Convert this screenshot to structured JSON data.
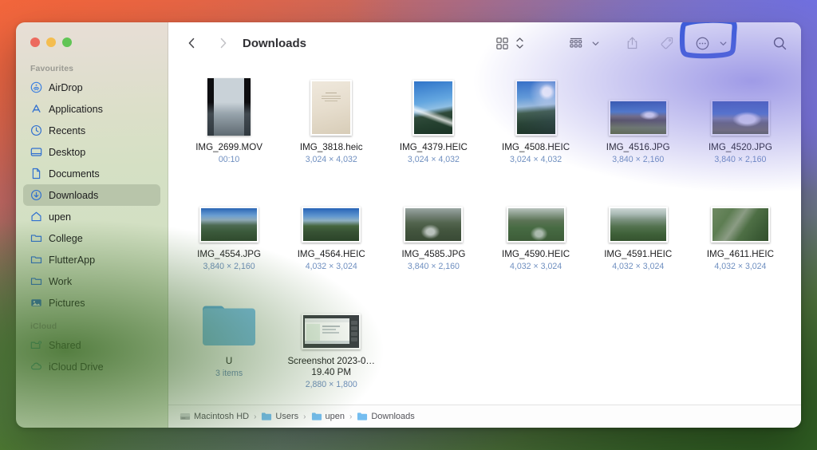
{
  "window": {
    "title": "Downloads",
    "traffic_lights": [
      {
        "name": "close",
        "color": "#ec6a5f"
      },
      {
        "name": "minimize",
        "color": "#f4bd4f"
      },
      {
        "name": "maximize",
        "color": "#61c555"
      }
    ]
  },
  "sidebar": {
    "sections": [
      {
        "title": "Favourites",
        "items": [
          {
            "label": "AirDrop",
            "icon": "airdrop-icon",
            "selected": false
          },
          {
            "label": "Applications",
            "icon": "applications-icon",
            "selected": false
          },
          {
            "label": "Recents",
            "icon": "clock-icon",
            "selected": false
          },
          {
            "label": "Desktop",
            "icon": "desktop-icon",
            "selected": false
          },
          {
            "label": "Documents",
            "icon": "document-icon",
            "selected": false
          },
          {
            "label": "Downloads",
            "icon": "download-icon",
            "selected": true
          },
          {
            "label": "upen",
            "icon": "home-icon",
            "selected": false
          },
          {
            "label": "College",
            "icon": "folder-icon",
            "selected": false
          },
          {
            "label": "FlutterApp",
            "icon": "folder-icon",
            "selected": false
          },
          {
            "label": "Work",
            "icon": "folder-icon",
            "selected": false
          },
          {
            "label": "Pictures",
            "icon": "pictures-icon",
            "selected": false
          }
        ]
      },
      {
        "title": "iCloud",
        "items": [
          {
            "label": "Shared",
            "icon": "shared-folder-icon",
            "selected": false
          },
          {
            "label": "iCloud Drive",
            "icon": "cloud-icon",
            "selected": false
          }
        ]
      }
    ]
  },
  "toolbar": {
    "back_label": "Back",
    "forward_label": "Forward",
    "items": [
      {
        "name": "icon-view-button",
        "icon": "grid-view-icon"
      },
      {
        "name": "sort-stepper",
        "icon": "chevron-up-down-icon"
      },
      {
        "name": "group-by-button",
        "icon": "group-list-icon"
      },
      {
        "name": "group-by-chevron",
        "icon": "chevron-down-icon"
      },
      {
        "name": "share-button",
        "icon": "share-icon"
      },
      {
        "name": "tag-button",
        "icon": "tag-icon"
      },
      {
        "name": "more-actions-button",
        "icon": "ellipsis-circle-icon"
      },
      {
        "name": "more-actions-chevron",
        "icon": "chevron-down-icon"
      },
      {
        "name": "search-button",
        "icon": "search-icon"
      }
    ],
    "annotation": {
      "target": "more-actions-button",
      "shape": "hand-drawn-rectangle",
      "color": "#2554d8"
    }
  },
  "files": [
    {
      "name": "IMG_2699.MOV",
      "meta": "00:10",
      "kind": "movie",
      "thumb": "snow-dark-video"
    },
    {
      "name": "IMG_3818.heic",
      "meta": "3,024 × 4,032",
      "kind": "portrait",
      "thumb": "paper-document"
    },
    {
      "name": "IMG_4379.HEIC",
      "meta": "3,024 × 4,032",
      "kind": "portrait",
      "thumb": "mountain-blue-sky"
    },
    {
      "name": "IMG_4508.HEIC",
      "meta": "3,024 × 4,032",
      "kind": "portrait",
      "thumb": "sunburst-valley"
    },
    {
      "name": "IMG_4516.JPG",
      "meta": "3,840 × 2,160",
      "kind": "landscape",
      "thumb": "rocky-peak"
    },
    {
      "name": "IMG_4520.JPG",
      "meta": "3,840 × 2,160",
      "kind": "landscape",
      "thumb": "snow-peak-blue"
    },
    {
      "name": "IMG_4554.JPG",
      "meta": "3,840 × 2,160",
      "kind": "landscape",
      "thumb": "valley-green"
    },
    {
      "name": "IMG_4564.HEIC",
      "meta": "4,032 × 3,024",
      "kind": "landscape",
      "thumb": "valley-blue-haze"
    },
    {
      "name": "IMG_4585.JPG",
      "meta": "3,840 × 2,160",
      "kind": "landscape",
      "thumb": "winding-river"
    },
    {
      "name": "IMG_4590.HEIC",
      "meta": "4,032 × 3,024",
      "kind": "landscape",
      "thumb": "green-mountain-road"
    },
    {
      "name": "IMG_4591.HEIC",
      "meta": "4,032 × 3,024",
      "kind": "landscape",
      "thumb": "misty-hills"
    },
    {
      "name": "IMG_4611.HEIC",
      "meta": "4,032 × 3,024",
      "kind": "landscape",
      "thumb": "hillside-village"
    },
    {
      "name": "U",
      "meta": "3 items",
      "kind": "folder",
      "thumb": "blue-folder"
    },
    {
      "name": "Screenshot 2023-0…19.40 PM",
      "meta": "2,880 × 1,800",
      "kind": "landscape",
      "thumb": "screenshot-window"
    }
  ],
  "path_bar": {
    "crumbs": [
      {
        "label": "Macintosh HD",
        "icon": "hard-drive-icon"
      },
      {
        "label": "Users",
        "icon": "folder-icon"
      },
      {
        "label": "upen",
        "icon": "folder-icon"
      },
      {
        "label": "Downloads",
        "icon": "folder-icon"
      }
    ],
    "separator": "›"
  }
}
